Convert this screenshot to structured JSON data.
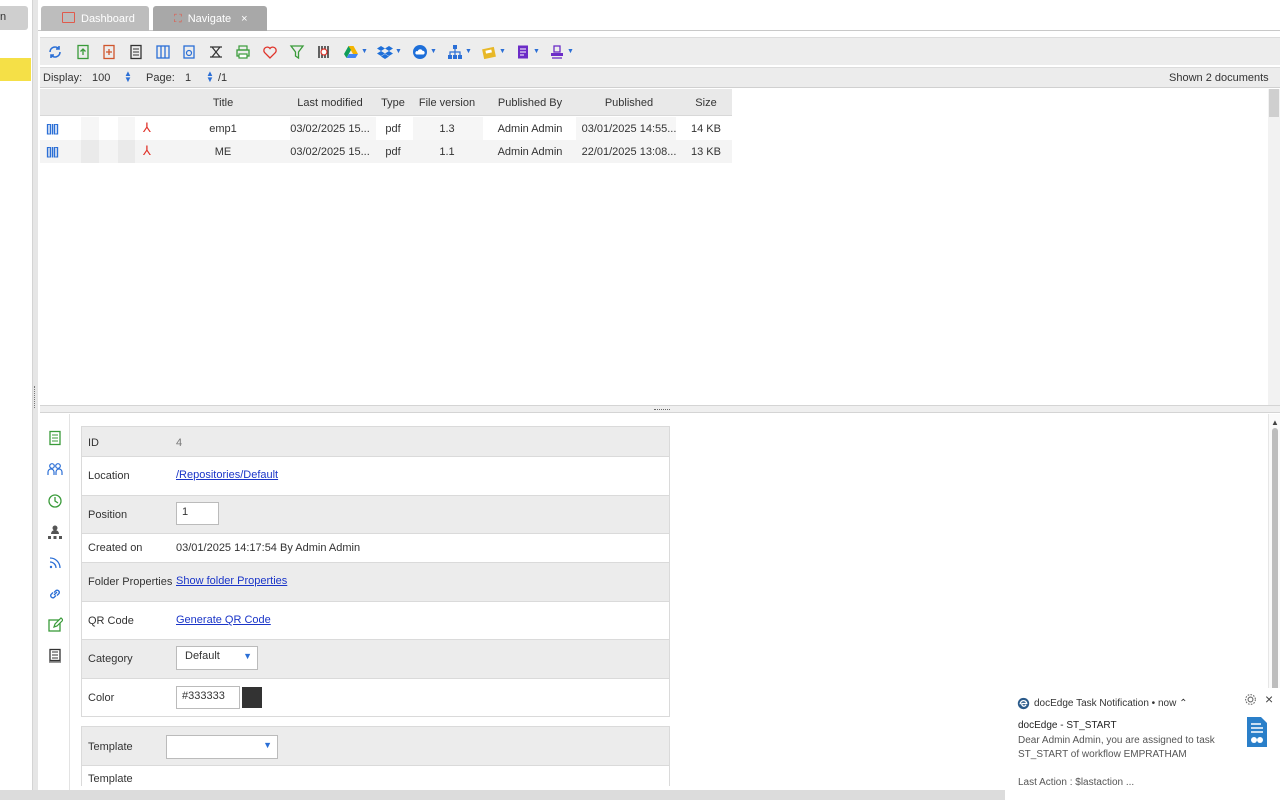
{
  "sidebar": {
    "top_label": "n"
  },
  "tabs": [
    {
      "label": "Dashboard",
      "active": false
    },
    {
      "label": "Navigate",
      "active": true,
      "close": "×"
    }
  ],
  "toolbar": {
    "icons": [
      "refresh-icon",
      "upload-icon",
      "add-document-icon",
      "archive-icon",
      "columns-icon",
      "scan-icon",
      "merge-icon",
      "print-icon",
      "favorite-icon",
      "filter-icon",
      "barcode-settings-icon",
      "google-drive-icon",
      "dropbox-icon",
      "cloud-icon",
      "workflow-icon",
      "zip-icon",
      "office-icon",
      "stamp-icon"
    ]
  },
  "pagebar": {
    "display_label": "Display:",
    "display_value": "100",
    "page_label": "Page:",
    "page_value": "1",
    "page_total": "/1",
    "shown": "Shown 2 documents"
  },
  "grid": {
    "columns": [
      "Title",
      "Last modified",
      "Type",
      "File version",
      "Published By",
      "Published",
      "Size"
    ],
    "rows": [
      {
        "title": "emp1",
        "last_modified": "03/02/2025 15...",
        "type": "pdf",
        "version": "1.3",
        "published_by": "Admin Admin",
        "published": "03/01/2025 14:55...",
        "size": "14 KB"
      },
      {
        "title": "ME",
        "last_modified": "03/02/2025 15...",
        "type": "pdf",
        "version": "1.1",
        "published_by": "Admin Admin",
        "published": "22/01/2025 13:08...",
        "size": "13 KB"
      }
    ]
  },
  "properties": {
    "id_label": "ID",
    "id_value": "4",
    "location_label": "Location",
    "location_value": "/Repositories/Default",
    "position_label": "Position",
    "position_value": "1",
    "created_label": "Created on",
    "created_value": "03/01/2025 14:17:54 By Admin Admin",
    "folder_props_label": "Folder Properties",
    "folder_props_link": "Show folder Properties",
    "qr_label": "QR Code",
    "qr_link": "Generate QR Code",
    "category_label": "Category",
    "category_value": "Default",
    "color_label": "Color",
    "color_value": "#333333",
    "color_swatch": "#333333",
    "template_label": "Template",
    "template_value": "",
    "template2_label": "Template"
  },
  "notification": {
    "app": "docEdge Task Notification",
    "time": "now",
    "title": "docEdge - ST_START",
    "body": "Dear Admin Admin, you are assigned to task ST_START of workflow EMPRATHAM",
    "last_action": "Last Action : $lastaction ..."
  },
  "colors": {
    "accent": "#2b6fd6",
    "selected": "#f5e047",
    "link": "#1a35c8",
    "pdf": "#e0332a",
    "green": "#3a9b3a"
  }
}
